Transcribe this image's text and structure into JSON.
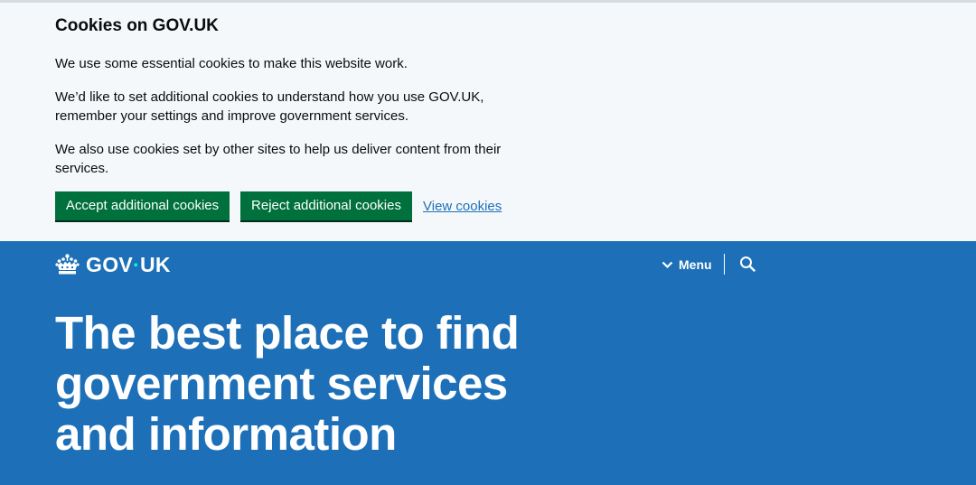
{
  "cookie_banner": {
    "title": "Cookies on GOV.UK",
    "paragraph_1": "We use some essential cookies to make this website work.",
    "paragraph_2": "We’d like to set additional cookies to understand how you use GOV.UK, remember your settings and improve government services.",
    "paragraph_3": "We also use cookies set by other sites to help us deliver content from their services.",
    "accept_label": "Accept additional cookies",
    "reject_label": "Reject additional cookies",
    "view_label": "View cookies"
  },
  "header": {
    "logo_left": "GOV",
    "logo_dot": "·",
    "logo_right": "UK",
    "logo_icon": "crown-icon",
    "menu_label": "Menu",
    "menu_icon": "chevron-down-icon",
    "search_icon": "search-icon"
  },
  "hero": {
    "title": "The best place to find government services and information"
  },
  "colors": {
    "brand_blue": "#1d70b8",
    "button_green": "#00703c",
    "banner_bg": "#f4f8fb",
    "link_blue": "#1d70b8",
    "logo_dot": "#00ffe0"
  }
}
